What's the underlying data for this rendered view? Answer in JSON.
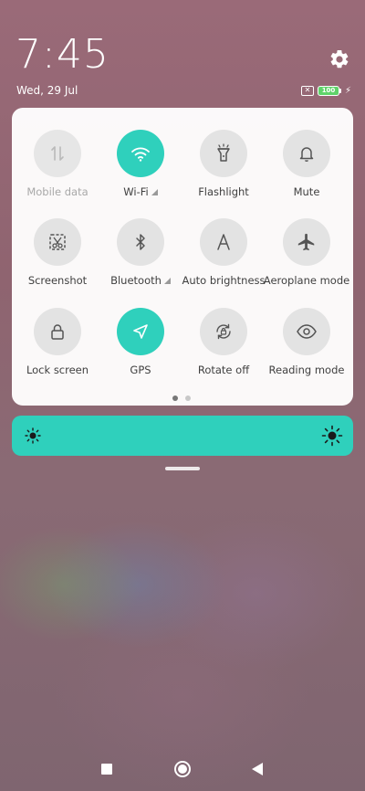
{
  "status": {
    "time": "7:45",
    "date": "Wed, 29 Jul",
    "battery_level": "100",
    "icons": [
      "gear-icon",
      "sim-off-icon",
      "battery-icon",
      "charging-icon"
    ]
  },
  "quick_settings": {
    "tiles": [
      {
        "label": "Mobile data",
        "icon": "mobile-data-icon",
        "state": "disabled"
      },
      {
        "label": "Wi-Fi",
        "icon": "wifi-icon",
        "state": "on"
      },
      {
        "label": "Flashlight",
        "icon": "flashlight-icon",
        "state": "off"
      },
      {
        "label": "Mute",
        "icon": "bell-icon",
        "state": "off"
      },
      {
        "label": "Screenshot",
        "icon": "screenshot-icon",
        "state": "off"
      },
      {
        "label": "Bluetooth",
        "icon": "bluetooth-icon",
        "state": "off"
      },
      {
        "label": "Auto brightness",
        "icon": "auto-brightness-icon",
        "state": "off"
      },
      {
        "label": "Aeroplane mode",
        "icon": "airplane-icon",
        "state": "off"
      },
      {
        "label": "Lock screen",
        "icon": "lock-icon",
        "state": "off"
      },
      {
        "label": "GPS",
        "icon": "location-arrow-icon",
        "state": "on"
      },
      {
        "label": "Rotate off",
        "icon": "rotate-lock-icon",
        "state": "off"
      },
      {
        "label": "Reading mode",
        "icon": "eye-icon",
        "state": "off"
      }
    ],
    "page_count": 2,
    "active_page": 1
  },
  "colors": {
    "accent": "#2fd0bc",
    "tile_off": "#e3e3e3",
    "battery_green": "#5fd36a"
  },
  "navigation": {
    "icons": [
      "recents-square-icon",
      "home-circle-icon",
      "back-triangle-icon"
    ]
  }
}
